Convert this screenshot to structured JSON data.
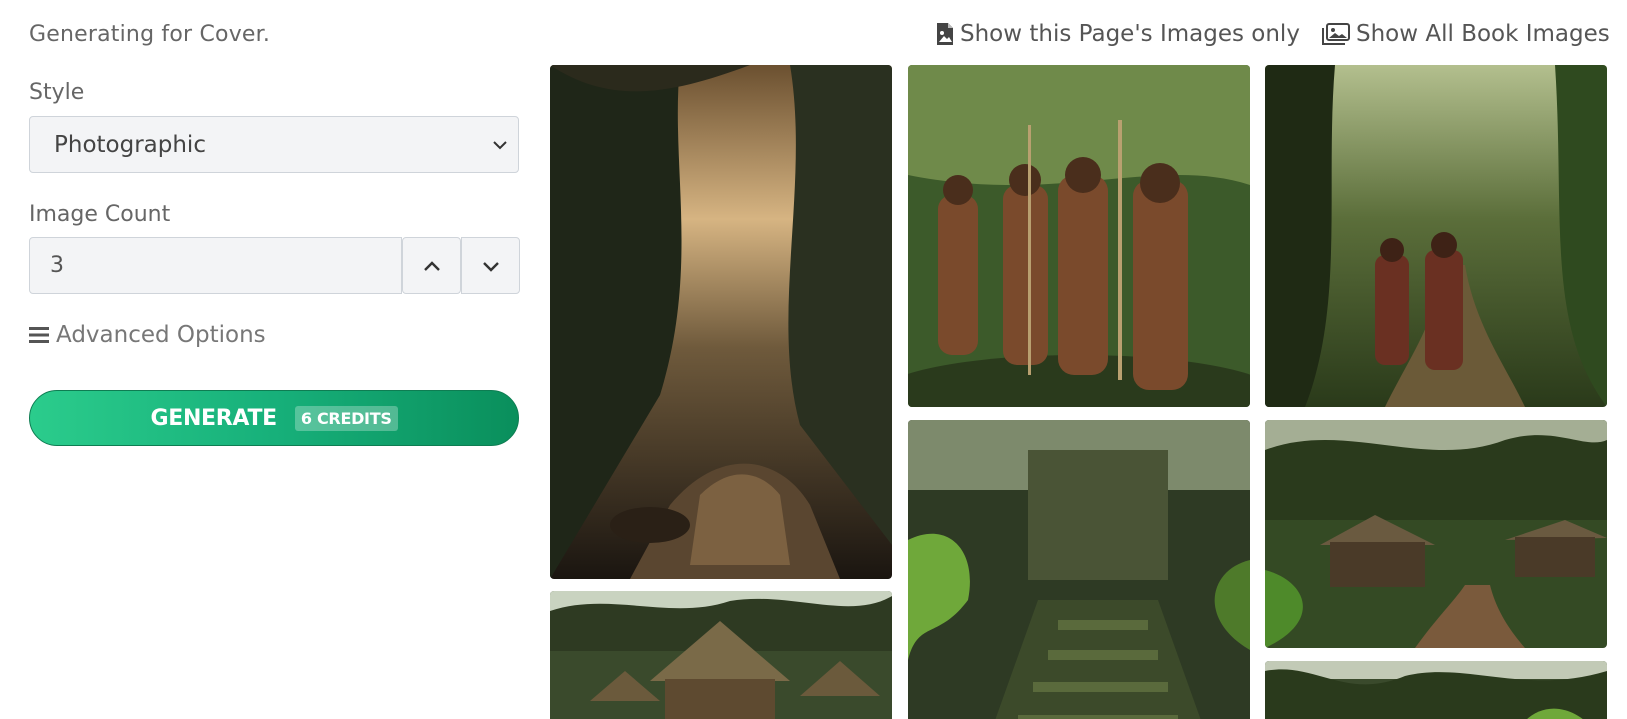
{
  "header": {
    "generating_for": "Generating for Cover.",
    "show_page_images": "Show this Page's Images only",
    "show_all_images": "Show All Book Images"
  },
  "form": {
    "style_label": "Style",
    "style_value": "Photographic",
    "count_label": "Image Count",
    "count_value": "3",
    "advanced_label": "Advanced Options",
    "generate_label": "GENERATE",
    "credits_label": "6 CREDITS"
  },
  "colors": {
    "accent_start": "#2bcc8c",
    "accent_end": "#0a8f5c"
  },
  "icons": {
    "page_images": "file-image-icon",
    "all_images": "images-icon",
    "advanced": "hamburger-icon",
    "select": "chevron-down-icon",
    "step_up": "chevron-up-icon",
    "step_down": "chevron-down-icon"
  },
  "gallery": {
    "image_count": 7
  }
}
